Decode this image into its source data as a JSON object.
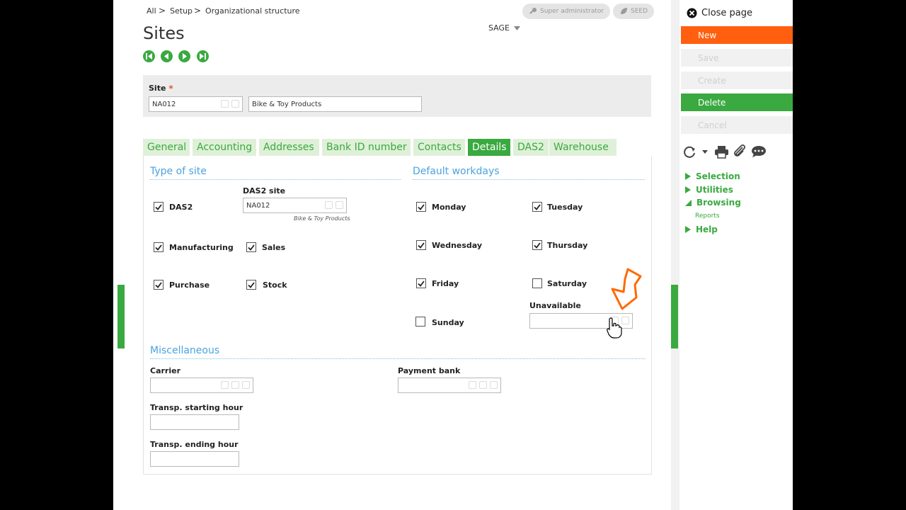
{
  "breadcrumb": {
    "items": [
      "All",
      "Setup",
      "Organizational structure"
    ],
    "separator": ">"
  },
  "user_badges": {
    "role": "Super administrator",
    "folder": "SEED"
  },
  "page_title": "Sites",
  "company_menu": "SAGE",
  "site": {
    "label": "Site",
    "required_mark": "*",
    "code": "NA012",
    "description": "Bike & Toy Products"
  },
  "tabs": [
    {
      "label": "General",
      "active": false
    },
    {
      "label": "Accounting",
      "active": false
    },
    {
      "label": "Addresses",
      "active": false
    },
    {
      "label": "Bank ID number",
      "active": false
    },
    {
      "label": "Contacts",
      "active": false
    },
    {
      "label": "Details",
      "active": true
    },
    {
      "label": "DAS2",
      "active": false
    },
    {
      "label": "Warehouse",
      "active": false
    }
  ],
  "type_of_site": {
    "title": "Type of site",
    "das2": {
      "label": "DAS2",
      "checked": true
    },
    "das2_site": {
      "label": "DAS2 site",
      "value": "NA012",
      "description": "Bike & Toy Products"
    },
    "manufacturing": {
      "label": "Manufacturing",
      "checked": true
    },
    "sales": {
      "label": "Sales",
      "checked": true
    },
    "purchase": {
      "label": "Purchase",
      "checked": true
    },
    "stock": {
      "label": "Stock",
      "checked": true
    }
  },
  "default_workdays": {
    "title": "Default workdays",
    "monday": {
      "label": "Monday",
      "checked": true
    },
    "tuesday": {
      "label": "Tuesday",
      "checked": true
    },
    "wednesday": {
      "label": "Wednesday",
      "checked": true
    },
    "thursday": {
      "label": "Thursday",
      "checked": true
    },
    "friday": {
      "label": "Friday",
      "checked": true
    },
    "saturday": {
      "label": "Saturday",
      "checked": false
    },
    "sunday": {
      "label": "Sunday",
      "checked": false
    },
    "unavailable": {
      "label": "Unavailable",
      "value": ""
    }
  },
  "miscellaneous": {
    "title": "Miscellaneous",
    "carrier": {
      "label": "Carrier",
      "value": ""
    },
    "payment_bank": {
      "label": "Payment bank",
      "value": ""
    },
    "transp_start": {
      "label": "Transp. starting hour",
      "value": ""
    },
    "transp_end": {
      "label": "Transp. ending hour",
      "value": ""
    }
  },
  "right_panel": {
    "close_label": "Close page",
    "buttons": {
      "new": {
        "label": "New",
        "color": "#ff5f0f"
      },
      "save": {
        "label": "Save"
      },
      "create": {
        "label": "Create"
      },
      "delete": {
        "label": "Delete",
        "color": "#3aa940"
      },
      "cancel": {
        "label": "Cancel"
      }
    },
    "menu": {
      "selection": "Selection",
      "utilities": "Utilities",
      "browsing": "Browsing",
      "reports": "Reports",
      "help": "Help"
    }
  },
  "colors": {
    "accent_green": "#3aa940",
    "tab_bg": "#dff0d8",
    "section_blue": "#4aa3df",
    "new_orange": "#ff5f0f",
    "arrow_orange": "#ff6a00"
  }
}
